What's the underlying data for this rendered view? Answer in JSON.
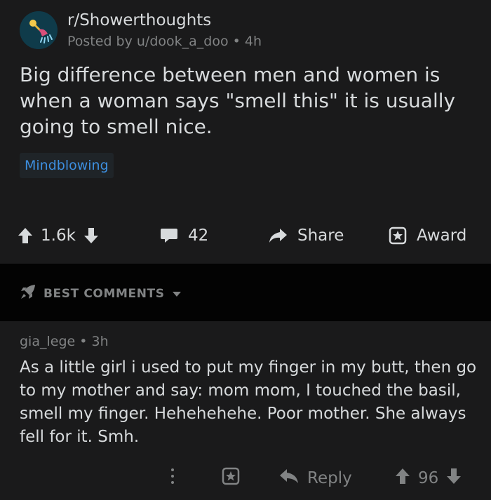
{
  "post": {
    "subreddit": "r/Showerthoughts",
    "posted_by": "Posted by u/dook_a_doo",
    "age": "4h",
    "title": "Big difference between men and women is when a woman says \"smell this\" it is usually going to smell nice.",
    "flair": "Mindblowing",
    "votes": "1.6k",
    "comments": "42",
    "share_label": "Share",
    "award_label": "Award"
  },
  "sort": {
    "label": "BEST COMMENTS"
  },
  "comment": {
    "author": "gia_lege",
    "age": "3h",
    "body": "As a little girl i used to put my finger in my butt, then go to my mother and say: mom mom, I touched the basil, smell my finger. Hehehehehe. Poor mother. She always fell for it. Smh.",
    "reply_label": "Reply",
    "votes": "96"
  },
  "colors": {
    "background": "#1a1a1b",
    "section_bar": "#030303",
    "text": "#d7dadc",
    "muted": "#818384",
    "flair_text": "#3d8fe0"
  }
}
